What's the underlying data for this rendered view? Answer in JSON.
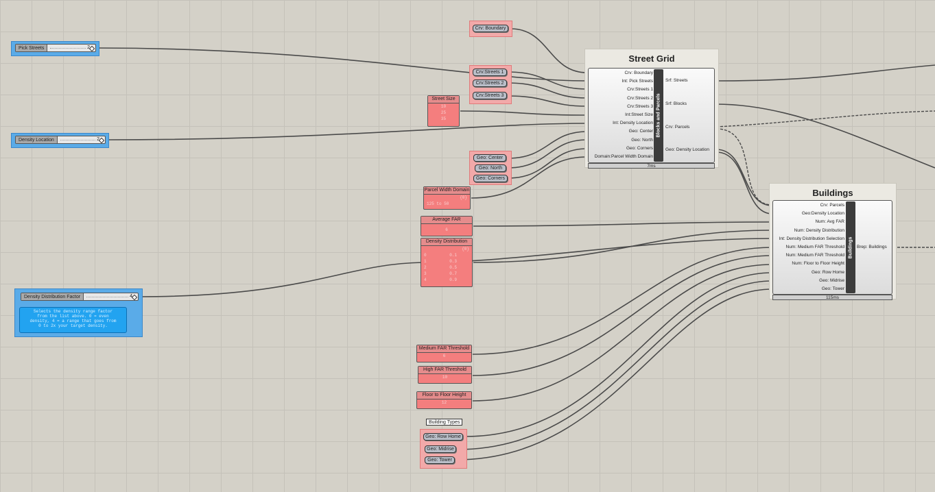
{
  "sliders": {
    "pick_streets": {
      "label": "Pick Streets",
      "value": "2"
    },
    "density_location": {
      "label": "Density Location",
      "value": "2"
    },
    "density_distribution_factor": {
      "label": "Density Distribution Factor",
      "value": "4"
    }
  },
  "note": {
    "line1": "Selects the density range factor",
    "line2": "from the list above. 0 = even",
    "line3": "density, 4 = a range that goes from",
    "line4": "0 to 2x your target density."
  },
  "params": {
    "crv_boundary": "Crv: Boundary",
    "crv_streets_1": "Crv:Streets 1",
    "crv_streets_2": "Crv:Streets 2",
    "crv_streets_3": "Crv:Streets 3",
    "geo_center": "Geo: Center",
    "geo_north": "Geo: North",
    "geo_corners": "Geo: Corners",
    "geo_row_home": "Geo: Row Home",
    "geo_midrise": "Geo: Midrise",
    "geo_tower": "Geo: Tower",
    "building_types": "Building Types"
  },
  "panels": {
    "street_size": {
      "title": "Street Size",
      "values": [
        "10",
        "25",
        "35"
      ]
    },
    "parcel_width_domain": {
      "title": "Parcel Width Domain",
      "value": "125 to 50",
      "count": "{0}"
    },
    "average_far": {
      "title": "Average FAR",
      "value": "6"
    },
    "density_distribution": {
      "title": "Density Distribution",
      "header": "{0}",
      "rows": [
        {
          "i": "0",
          "v": "0.1"
        },
        {
          "i": "1",
          "v": "0.3"
        },
        {
          "i": "2",
          "v": "0.5"
        },
        {
          "i": "3",
          "v": "0.7"
        },
        {
          "i": "4",
          "v": "0.9"
        }
      ]
    },
    "medium_far_threshold": {
      "title": "Medium FAR Threshold",
      "value": "6"
    },
    "high_far_threshold": {
      "title": "High FAR Threshold",
      "value": "10"
    },
    "floor_to_floor_height": {
      "title": "Floor to Floor Height",
      "value": "12"
    }
  },
  "street_grid": {
    "title": "Street Grid",
    "bar": "Blocks and Parcels",
    "inputs": [
      "Crv: Boundary",
      "Int: Pick Streets",
      "Crv:Streets 1",
      "Crv:Streets 2",
      "Crv:Streets 3",
      "Int:Street Size",
      "Int: Density Location",
      "Geo: Center",
      "Geo: North",
      "Geo: Corners",
      "Domain:Parcel Width Domain"
    ],
    "outputs": [
      "Srf: Streets",
      "Srf: Blocks",
      "Crv: Parcels",
      "Geo: Density Location"
    ],
    "time": "7ms"
  },
  "buildings": {
    "title": "Buildings",
    "bar": "Buildings",
    "inputs": [
      "Crv: Parcels",
      "Geo:Density Location",
      "Num: Avg FAR",
      "Num: Density Distribution",
      "Int: Density Distribution Selection",
      "Num: Medium FAR Threshold",
      "Num: Medium FAR Threshold",
      "Num: Floor to Floor Height",
      "Geo: Row Home",
      "Geo: Midrise",
      "Geo: Tower"
    ],
    "outputs": [
      "Brep: Buildings"
    ],
    "time": "115ms"
  },
  "colors": {
    "canvas": "#d4d1c8",
    "group_blue": "#5aabe8",
    "group_pink": "#f2a9a9",
    "panel_red": "#f47e7e",
    "wire": "#4a4a4a"
  }
}
